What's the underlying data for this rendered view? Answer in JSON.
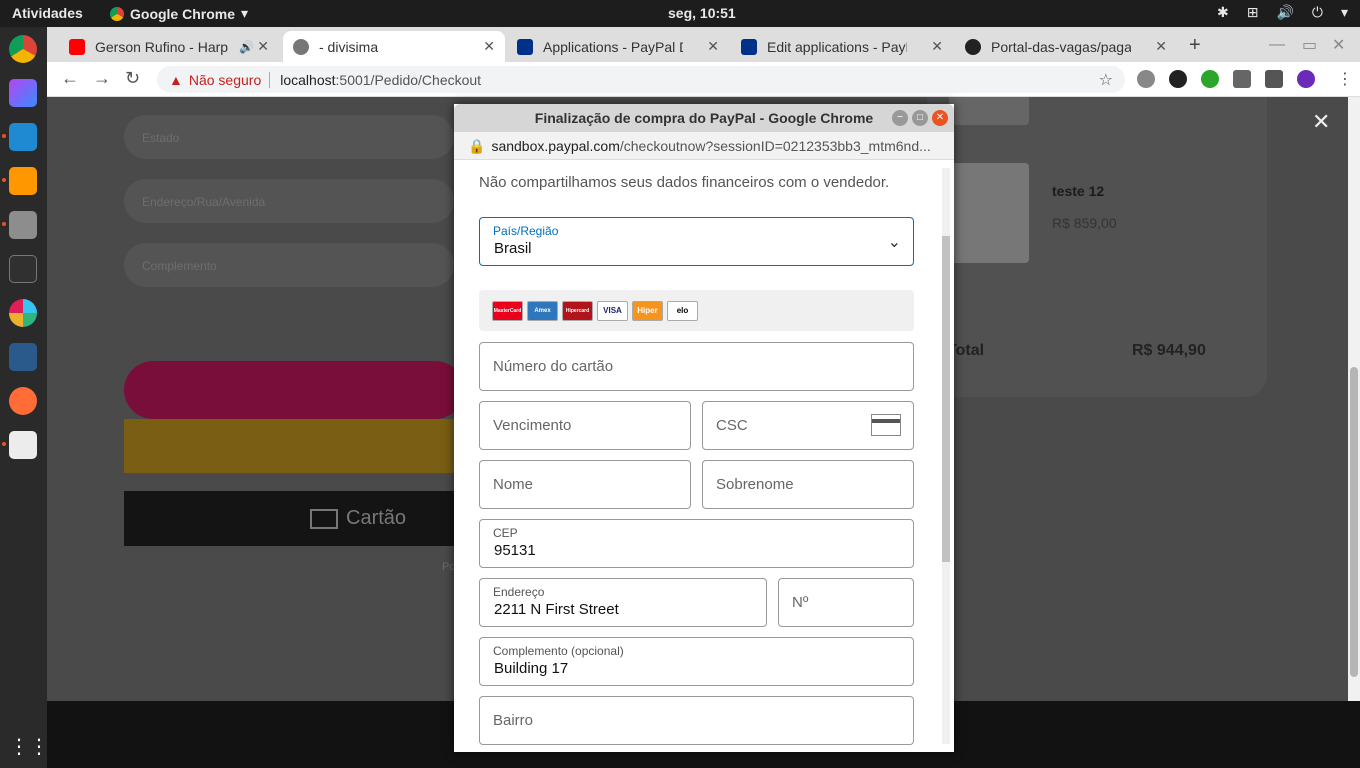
{
  "system": {
    "activities": "Atividades",
    "app_name": "Google Chrome",
    "clock": "seg, 10:51"
  },
  "tabs": [
    {
      "title": "Gerson Rufino - Harp",
      "favicon": "youtube-icon"
    },
    {
      "title": "- divisima",
      "favicon": "globe-icon"
    },
    {
      "title": "Applications - PayPal De",
      "favicon": "paypal-icon"
    },
    {
      "title": "Edit applications - PayP",
      "favicon": "paypal-icon"
    },
    {
      "title": "Portal-das-vagas/pagar",
      "favicon": "github-icon"
    }
  ],
  "address": {
    "security": "Não seguro",
    "url_host": "localhost",
    "url_path": ":5001/Pedido/Checkout"
  },
  "background_page": {
    "fields": [
      "Estado",
      "Endereço/Rua/Avenida",
      "Complemento"
    ],
    "card_button": "Cartão",
    "product_name": "teste 12",
    "product_price": "R$ 859,00",
    "total_label": "Total",
    "total_value": "R$ 944,90"
  },
  "popup": {
    "title": "Finalização de compra do PayPal - Google Chrome",
    "url_host": "sandbox.paypal.com",
    "url_rest": "/checkoutnow?sessionID=0212353bb3_mtm6nd...",
    "note": "Não compartilhamos seus dados financeiros com o vendedor.",
    "country_label": "País/Região",
    "country_value": "Brasil",
    "card_brands": [
      "MasterCard",
      "Amex",
      "Hipercard",
      "VISA",
      "Hiper",
      "elo"
    ],
    "card_number_ph": "Número do cartão",
    "expiry_ph": "Vencimento",
    "csc_ph": "CSC",
    "first_name_ph": "Nome",
    "last_name_ph": "Sobrenome",
    "cep_label": "CEP",
    "cep_value": "95131",
    "address_label": "Endereço",
    "address_value": "2211 N First Street",
    "number_ph": "Nº",
    "complement_label": "Complemento (opcional)",
    "complement_value": "Building 17",
    "district_ph": "Bairro"
  }
}
